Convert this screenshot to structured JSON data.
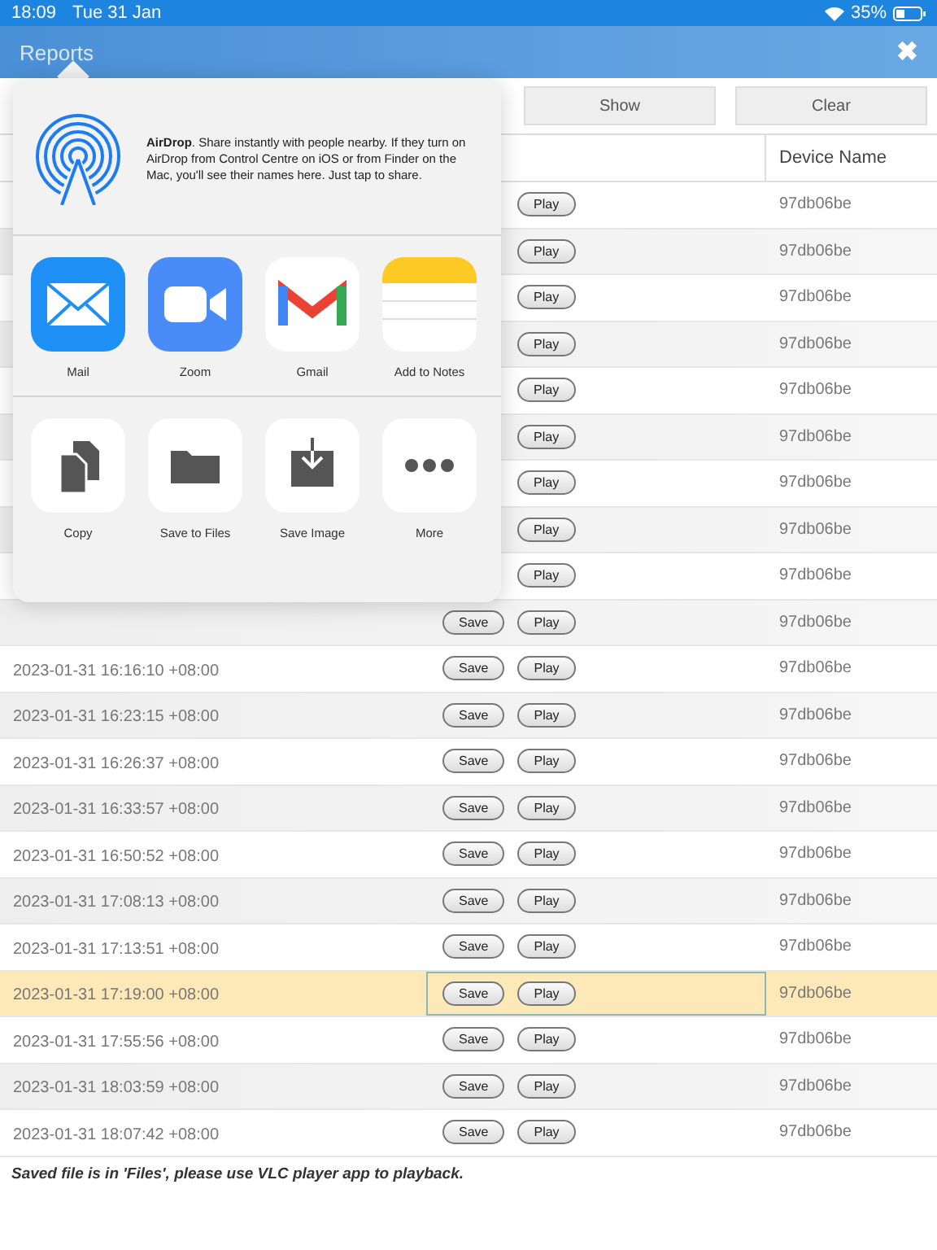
{
  "status_bar": {
    "time": "18:09",
    "date": "Tue 31 Jan",
    "battery": "35%"
  },
  "header": {
    "title": "Reports",
    "close": "✖"
  },
  "toolbar": {
    "buttons": [
      "Show",
      "Clear"
    ]
  },
  "table": {
    "columns": [
      "Device Name"
    ],
    "rows": [
      {
        "play": "Play",
        "device": "97db06be",
        "selected": false
      },
      {
        "play": "Play",
        "device": "97db06be",
        "selected": false
      },
      {
        "play": "Play",
        "device": "97db06be",
        "selected": false
      },
      {
        "play": "Play",
        "device": "97db06be",
        "selected": false
      },
      {
        "play": "Play",
        "device": "97db06be",
        "selected": false
      },
      {
        "play": "Play",
        "device": "97db06be",
        "selected": false
      },
      {
        "play": "Play",
        "device": "97db06be",
        "selected": false
      },
      {
        "play": "Play",
        "device": "97db06be",
        "selected": false
      },
      {
        "play": "Play",
        "device": "97db06be",
        "selected": false
      },
      {
        "save": "Save",
        "play": "Play",
        "device": "97db06be",
        "selected": false
      },
      {
        "date": "2023-01-31 16:16:10 +08:00",
        "save": "Save",
        "play": "Play",
        "device": "97db06be",
        "selected": false
      },
      {
        "date": "2023-01-31 16:23:15 +08:00",
        "save": "Save",
        "play": "Play",
        "device": "97db06be",
        "selected": false
      },
      {
        "date": "2023-01-31 16:26:37 +08:00",
        "save": "Save",
        "play": "Play",
        "device": "97db06be",
        "selected": false
      },
      {
        "date": "2023-01-31 16:33:57 +08:00",
        "save": "Save",
        "play": "Play",
        "device": "97db06be",
        "selected": false
      },
      {
        "date": "2023-01-31 16:50:52 +08:00",
        "save": "Save",
        "play": "Play",
        "device": "97db06be",
        "selected": false
      },
      {
        "date": "2023-01-31 17:08:13 +08:00",
        "save": "Save",
        "play": "Play",
        "device": "97db06be",
        "selected": false
      },
      {
        "date": "2023-01-31 17:13:51 +08:00",
        "save": "Save",
        "play": "Play",
        "device": "97db06be",
        "selected": false
      },
      {
        "date": "2023-01-31 17:19:00 +08:00",
        "save": "Save",
        "play": "Play",
        "device": "97db06be",
        "selected": true
      },
      {
        "date": "2023-01-31 17:55:56 +08:00",
        "save": "Save",
        "play": "Play",
        "device": "97db06be",
        "selected": false
      },
      {
        "date": "2023-01-31 18:03:59 +08:00",
        "save": "Save",
        "play": "Play",
        "device": "97db06be",
        "selected": false
      },
      {
        "date": "2023-01-31 18:07:42 +08:00",
        "save": "Save",
        "play": "Play",
        "device": "97db06be",
        "selected": false
      }
    ]
  },
  "footer_note": "Saved file is in 'Files', please use VLC player app to playback.",
  "share_sheet": {
    "airdrop": "**AirDrop**. Share instantly with people nearby. If they turn on AirDrop from Control Centre on iOS or from Finder on the Mac, you'll see their names here. Just tap to share.",
    "apps": [
      {
        "kind": "mail",
        "label": "Mail"
      },
      {
        "kind": "zoom",
        "label": "Zoom"
      },
      {
        "kind": "gmail",
        "label": "Gmail"
      },
      {
        "kind": "notes",
        "label": "Add to Notes"
      }
    ],
    "actions": [
      {
        "kind": "copy",
        "label": "Copy"
      },
      {
        "kind": "files",
        "label": "Save to Files"
      },
      {
        "kind": "saveimage",
        "label": "Save Image"
      },
      {
        "kind": "more",
        "label": "More"
      }
    ]
  }
}
